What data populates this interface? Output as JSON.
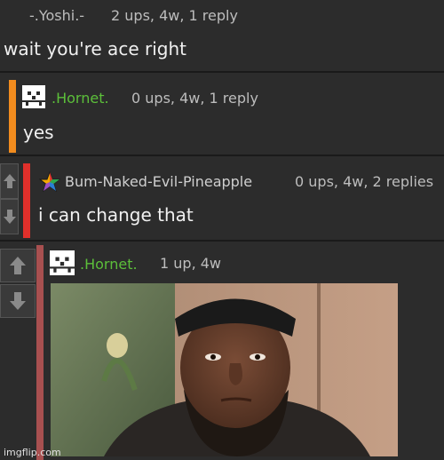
{
  "comments": [
    {
      "username": "-.Yoshi.-",
      "meta": "2 ups, 4w, 1 reply",
      "text": "wait you're ace right"
    },
    {
      "username": ".Hornet.",
      "meta": "0 ups, 4w, 1 reply",
      "text": "yes",
      "bar_color": "#f28c1e",
      "user_color": "#5cbf3a"
    },
    {
      "username": "Bum-Naked-Evil-Pineapple",
      "meta": "0 ups, 4w, 2 replies",
      "text": "i can change that",
      "bar_color": "#e0302b"
    },
    {
      "username": ".Hornet.",
      "meta": "1 up, 4w",
      "bar_color": "#a85050",
      "user_color": "#5cbf3a"
    }
  ],
  "icons": {
    "upvote": "arrow-up-icon",
    "downvote": "arrow-down-icon",
    "avatar_hornet": "pixel-face-avatar",
    "avatar_pineapple": "star-avatar"
  },
  "watermark": "imgflip.com"
}
